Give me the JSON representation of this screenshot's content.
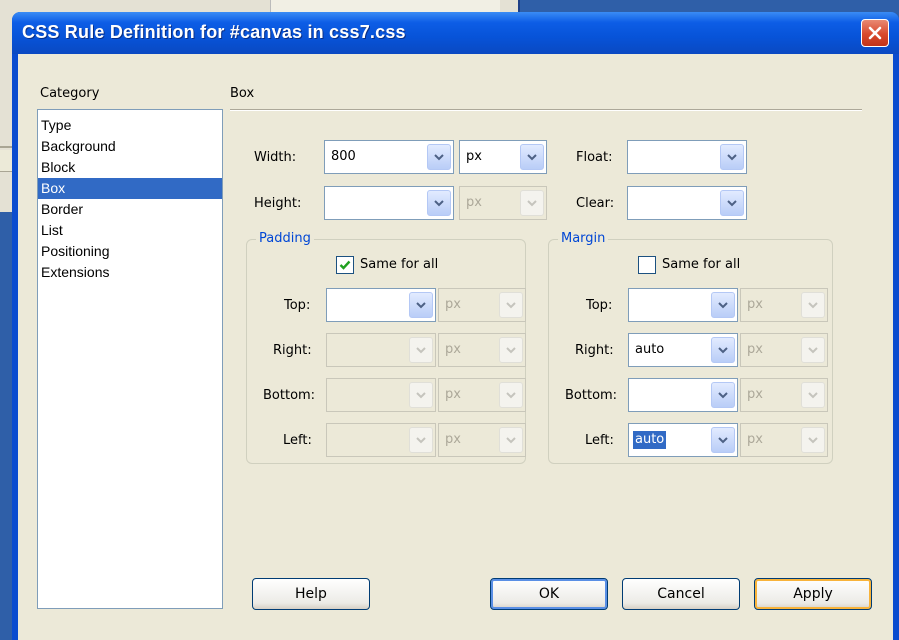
{
  "dialog": {
    "title": "CSS Rule Definition for #canvas in css7.css"
  },
  "category": {
    "label": "Category",
    "items": [
      "Type",
      "Background",
      "Block",
      "Box",
      "Border",
      "List",
      "Positioning",
      "Extensions"
    ],
    "selected": "Box"
  },
  "section": {
    "title": "Box"
  },
  "box": {
    "width": {
      "label": "Width:",
      "value": "800",
      "unit": "px"
    },
    "height": {
      "label": "Height:",
      "value": "",
      "unit": "px"
    },
    "float": {
      "label": "Float:",
      "value": ""
    },
    "clear": {
      "label": "Clear:",
      "value": ""
    }
  },
  "padding": {
    "title": "Padding",
    "same_for_all": {
      "label": "Same for all",
      "checked": true
    },
    "top": {
      "label": "Top:",
      "value": "",
      "unit": "px"
    },
    "right": {
      "label": "Right:",
      "value": "",
      "unit": "px"
    },
    "bottom": {
      "label": "Bottom:",
      "value": "",
      "unit": "px"
    },
    "left": {
      "label": "Left:",
      "value": "",
      "unit": "px"
    }
  },
  "margin": {
    "title": "Margin",
    "same_for_all": {
      "label": "Same for all",
      "checked": false
    },
    "top": {
      "label": "Top:",
      "value": "",
      "unit": "px"
    },
    "right": {
      "label": "Right:",
      "value": "auto",
      "unit": "px"
    },
    "bottom": {
      "label": "Bottom:",
      "value": "",
      "unit": "px"
    },
    "left": {
      "label": "Left:",
      "value": "auto",
      "unit": "px"
    }
  },
  "buttons": {
    "help": "Help",
    "ok": "OK",
    "cancel": "Cancel",
    "apply": "Apply"
  },
  "icons": {
    "close": "close-icon",
    "dropdown": "chevron-down-icon",
    "check": "checkmark-icon"
  },
  "colors": {
    "titlebar": "#0a4ccf",
    "selection": "#316ac5",
    "group_title": "#0046d5",
    "close": "#d8492c"
  }
}
